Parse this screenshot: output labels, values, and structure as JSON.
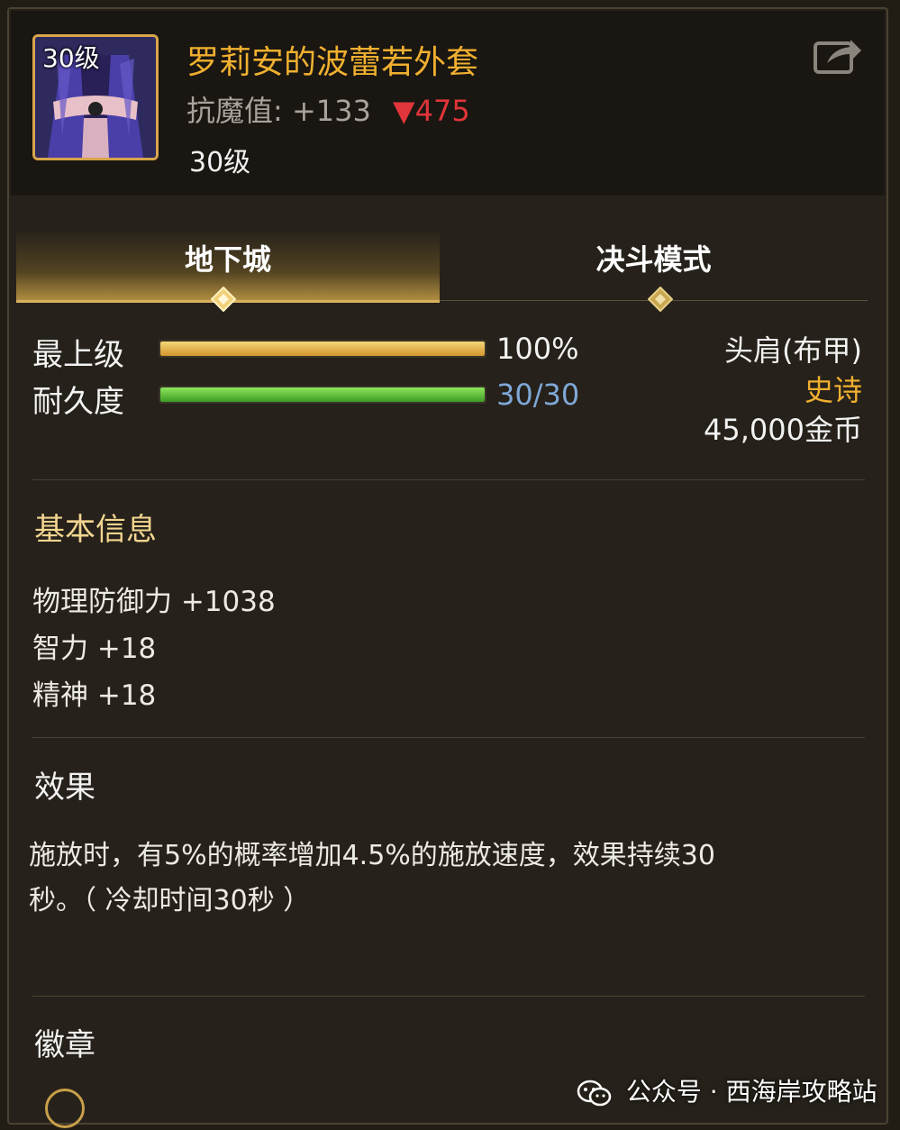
{
  "item": {
    "icon_level": "30级",
    "name": "罗莉安的波蕾若外套",
    "stat_label": "抗魔值:",
    "stat_value": "+133",
    "stat_diff": "▼475",
    "required_level": "30级",
    "share_icon": "share-export-icon",
    "icon": "purple-coat-armor-icon"
  },
  "tabs": [
    {
      "label": "地下城",
      "active": true
    },
    {
      "label": "决斗模式",
      "active": false
    }
  ],
  "bars": {
    "grade": {
      "label": "最上级",
      "value_text": "100%",
      "fill": 1.0
    },
    "durability": {
      "label": "耐久度",
      "value_text": "30/30",
      "fill": 1.0
    }
  },
  "info": {
    "slot": "头肩(布甲)",
    "rarity": "史诗",
    "price": "45,000金币"
  },
  "basic": {
    "title": "基本信息",
    "attrs": [
      "物理防御力 +1038",
      "智力 +18",
      "精神 +18"
    ]
  },
  "effect": {
    "title": "效果",
    "line1": "施放时，有5%的概率增加4.5%的施放速度，效果持续30",
    "line2": "秒。（ 冷却时间30秒 ）"
  },
  "badge": {
    "title": "徽章"
  },
  "watermark": {
    "text": "公众号 · 西海岸攻略站"
  },
  "colors": {
    "name": "#f0b030",
    "rarity_epic": "#f0b030",
    "stat_down": "#e0353a",
    "durability_value": "#7fa8d8"
  }
}
